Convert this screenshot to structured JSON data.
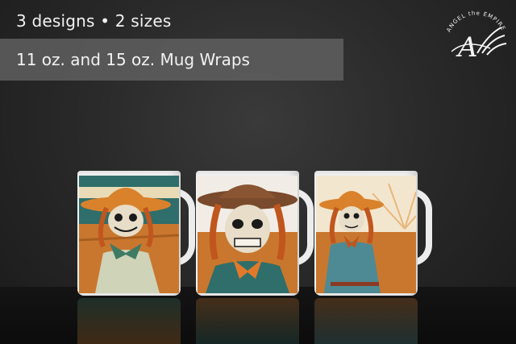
{
  "header": {
    "headline": "3 designs • 2 sizes",
    "subheadline": "11 oz. and 15 oz. Mug Wraps"
  },
  "logo": {
    "brand_text": "ANGEL the EMPIRE",
    "monogram": "A",
    "icon": "wheat-sheaf-icon"
  },
  "products": [
    {
      "name": "mug-1",
      "design": "scarecrow-orange-hat-green-bow"
    },
    {
      "name": "mug-2",
      "design": "scarecrow-skull-brown-hat"
    },
    {
      "name": "mug-3",
      "design": "scarecrow-sunburst-field"
    }
  ],
  "colors": {
    "background": "#2a2a2a",
    "banner": "#5f5f5f",
    "hat_orange": "#d9822b",
    "sky_teal": "#2f6e6a",
    "field_orange": "#c9772e"
  }
}
